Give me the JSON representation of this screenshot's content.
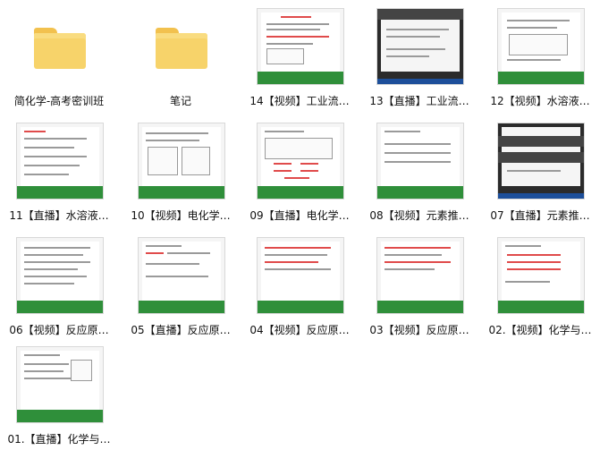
{
  "items": [
    {
      "type": "folder",
      "label": "简化学-高考密训班"
    },
    {
      "type": "folder",
      "label": "笔记"
    },
    {
      "type": "video",
      "label": "14【视频】工业流…"
    },
    {
      "type": "video",
      "label": "13【直播】工业流…"
    },
    {
      "type": "video",
      "label": "12【视频】水溶液…"
    },
    {
      "type": "video",
      "label": "11【直播】水溶液…"
    },
    {
      "type": "video",
      "label": "10【视频】电化学…"
    },
    {
      "type": "video",
      "label": "09【直播】电化学…"
    },
    {
      "type": "video",
      "label": "08【视频】元素推…"
    },
    {
      "type": "video",
      "label": "07【直播】元素推…"
    },
    {
      "type": "video",
      "label": "06【视频】反应原…"
    },
    {
      "type": "video",
      "label": "05【直播】反应原…"
    },
    {
      "type": "video",
      "label": "04【视频】反应原…"
    },
    {
      "type": "video",
      "label": "03【视频】反应原…"
    },
    {
      "type": "video",
      "label": "02.【视频】化学与…"
    },
    {
      "type": "video",
      "label": "01.【直播】化学与…"
    }
  ]
}
